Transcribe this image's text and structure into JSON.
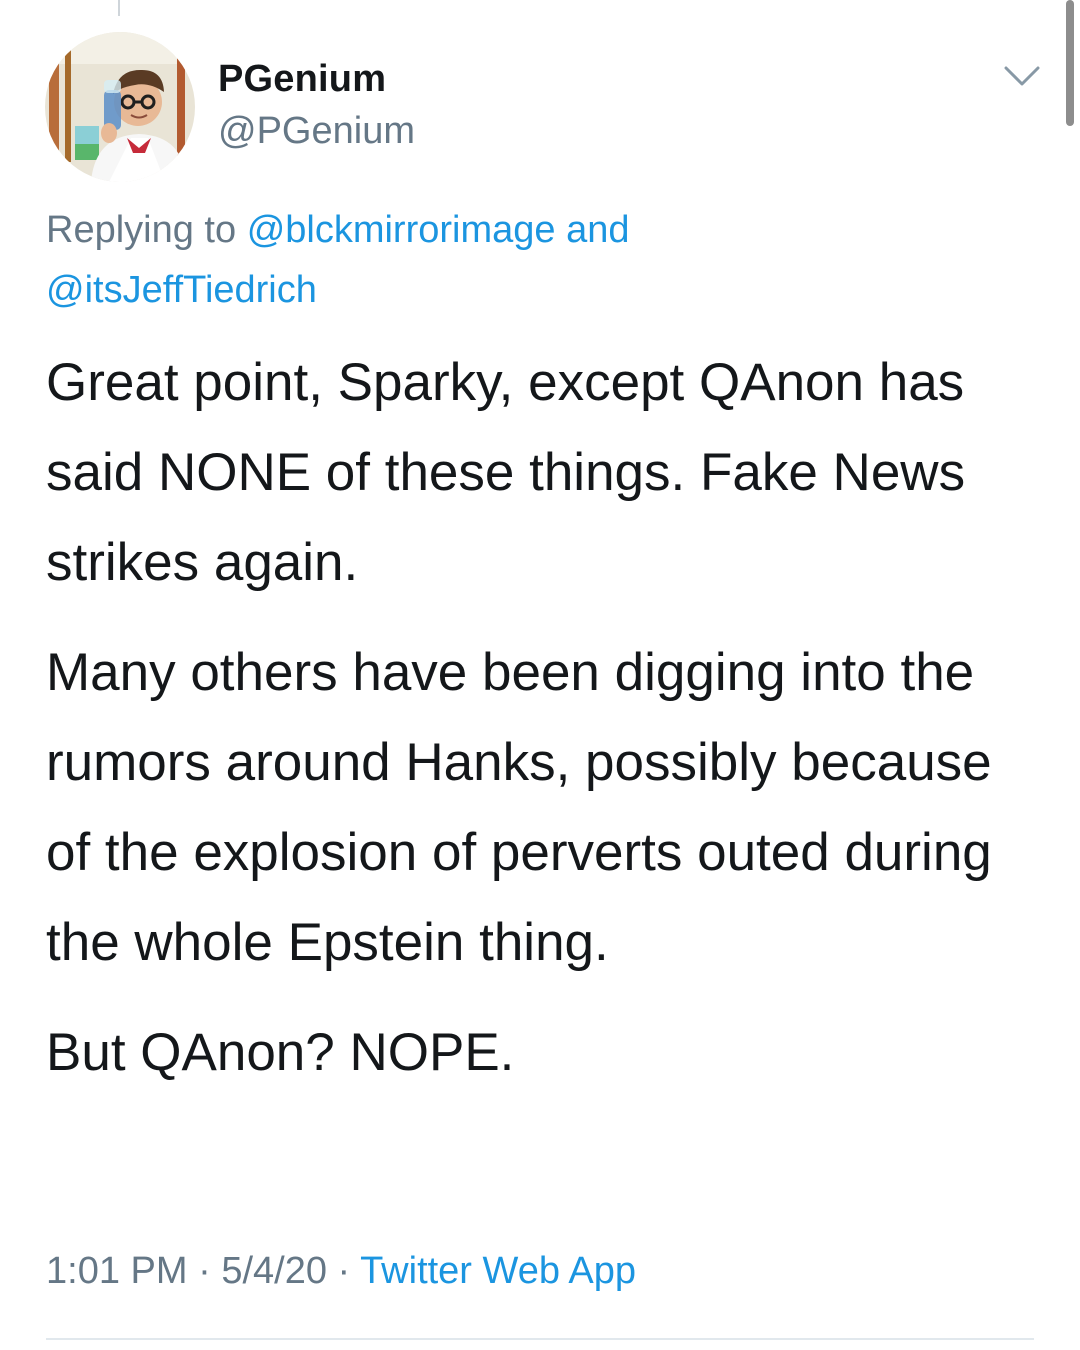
{
  "tweet": {
    "display_name": "PGenium",
    "handle": "@PGenium",
    "replying_prefix": "Replying to",
    "reply_mentions": [
      "@blckmirrorimage",
      "@itsJeffTiedrich"
    ],
    "reply_joiner": "and",
    "paragraphs": [
      "Great point, Sparky, except QAnon has said NONE of these things. Fake News strikes again.",
      "Many others have been digging into the rumors around Hanks, possibly because of the explosion of perverts outed during the whole Epstein thing.",
      "But QAnon?  NOPE."
    ],
    "time": "1:01 PM",
    "date": "5/4/20",
    "separator": "·",
    "source": "Twitter Web App"
  },
  "icons": {
    "menu_caret": "chevron-down-icon",
    "avatar": "avatar"
  },
  "colors": {
    "text_primary": "#14171a",
    "text_secondary": "#657786",
    "link": "#1b95e0",
    "divider": "#e1e8ed"
  }
}
